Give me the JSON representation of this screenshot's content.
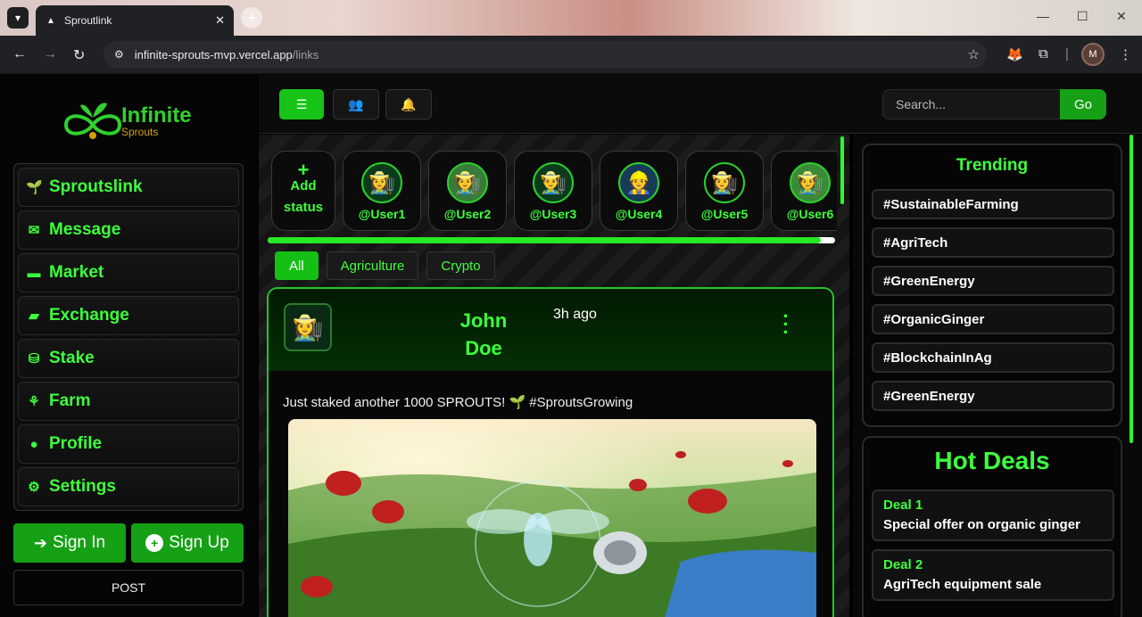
{
  "browser": {
    "tab_title": "Sproutlink",
    "url_host": "infinite-sprouts-mvp.vercel.app",
    "url_path": "/links",
    "profile_initial": "M"
  },
  "sidebar": {
    "logo_line1": "Infinite",
    "logo_line2": "Sprouts",
    "items": [
      {
        "label": "Sproutslink",
        "icon": "sprout-icon"
      },
      {
        "label": "Message",
        "icon": "envelope-icon"
      },
      {
        "label": "Market",
        "icon": "store-icon"
      },
      {
        "label": "Exchange",
        "icon": "wallet-icon"
      },
      {
        "label": "Stake",
        "icon": "coins-icon"
      },
      {
        "label": "Farm",
        "icon": "tractor-icon"
      },
      {
        "label": "Profile",
        "icon": "user-icon"
      },
      {
        "label": "Settings",
        "icon": "gear-icon"
      }
    ],
    "sign_in": "Sign In",
    "sign_up": "Sign Up",
    "post": "POST"
  },
  "topbar": {
    "search_placeholder": "Search...",
    "go": "Go"
  },
  "stories": {
    "add_plus": "+",
    "add_line1": "Add",
    "add_line2": "status",
    "users": [
      "@User1",
      "@User2",
      "@User3",
      "@User4",
      "@User5",
      "@User6"
    ]
  },
  "story_progress": 0.975,
  "filters": [
    "All",
    "Agriculture",
    "Crypto"
  ],
  "post": {
    "author_first": "John",
    "author_last": "Doe",
    "time": "3h ago",
    "text": "Just staked another 1000 SPROUTS! 🌱 #SproutsGrowing"
  },
  "trending": {
    "title": "Trending",
    "tags": [
      "#SustainableFarming",
      "#AgriTech",
      "#GreenEnergy",
      "#OrganicGinger",
      "#BlockchainInAg",
      "#GreenEnergy"
    ]
  },
  "deals": {
    "title": "Hot Deals",
    "items": [
      {
        "title": "Deal 1",
        "desc": "Special offer on organic ginger"
      },
      {
        "title": "Deal 2",
        "desc": "AgriTech equipment sale"
      }
    ]
  },
  "colors": {
    "accent": "#3dff3d",
    "button_green": "#15a015",
    "background": "#000000"
  }
}
